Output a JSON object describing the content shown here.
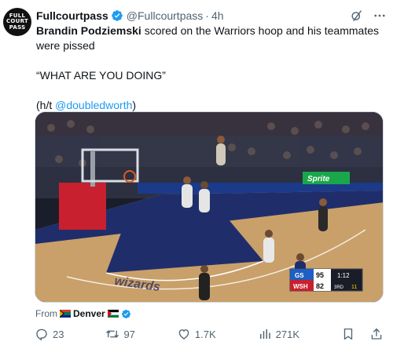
{
  "tweet": {
    "avatar_lines": [
      "FULL",
      "COURT",
      "PASS"
    ],
    "display_name": "Fullcourtpass",
    "handle": "@Fullcourtpass",
    "separator": "·",
    "time": "4h",
    "text_bold": "Brandin Podziemski",
    "text_rest": " scored on the Warriors hoop and his teammates were pissed",
    "quote": "“WHAT ARE YOU DOING”",
    "ht_prefix": "(h/t ",
    "ht_mention": "@doubledworth",
    "ht_suffix": ")"
  },
  "media": {
    "court_logo": "wizards",
    "sponsor": "Sprite",
    "scorebug": {
      "team1": "GS",
      "score1": "95",
      "team2": "WSH",
      "score2": "82",
      "clock": "1:12",
      "period": "3RD",
      "shot_clock": "11"
    }
  },
  "source": {
    "from_label": "From",
    "place": "Denver"
  },
  "actions": {
    "reply_count": "23",
    "retweet_count": "97",
    "like_count": "1.7K",
    "view_count": "271K"
  },
  "colors": {
    "accent": "#1d9bf0",
    "text_secondary": "#536471",
    "court": "#c9a06a",
    "paint": "#1f2e6b"
  }
}
